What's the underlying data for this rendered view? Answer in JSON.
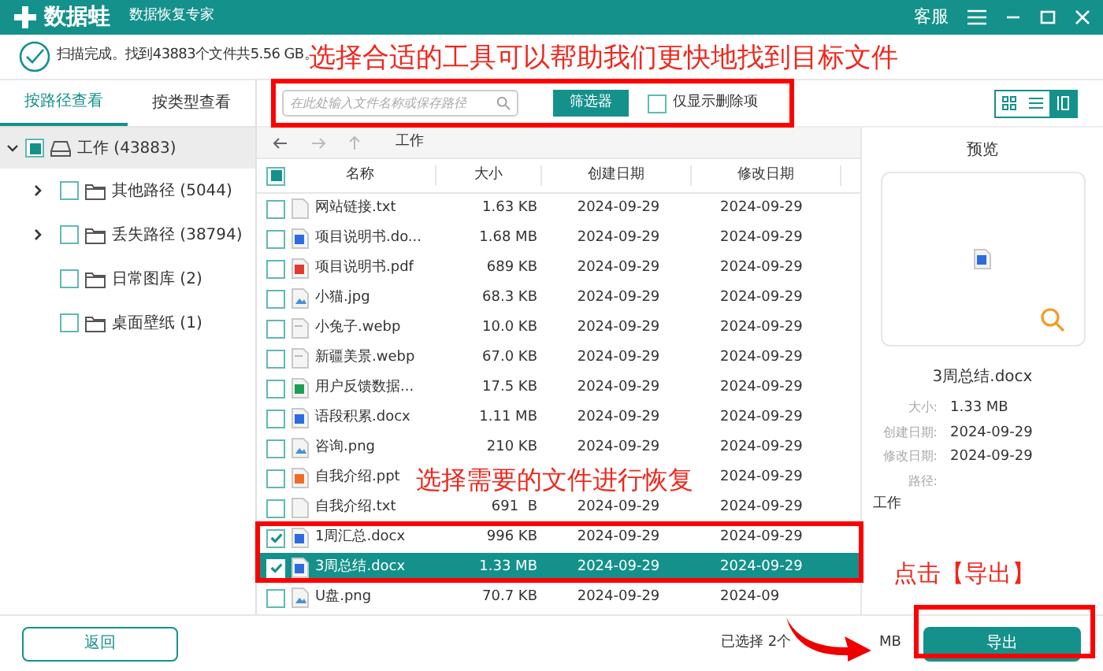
{
  "app": {
    "name": "数据蛙",
    "subtitle": "数据恢复专家",
    "support": "客服"
  },
  "scan_status": "扫描完成。找到43883个文件共5.56 GB。",
  "sidebar": {
    "tabs": [
      {
        "label": "按路径查看",
        "selected": true
      },
      {
        "label": "按类型查看",
        "selected": false
      }
    ],
    "tree": [
      {
        "label": "工作 (43883)",
        "checked": false,
        "indeterminate": true,
        "expanded": true,
        "kind": "drive",
        "selected": true,
        "children": [
          {
            "label": "其他路径 (5044)",
            "checked": false,
            "expandable": true,
            "kind": "folder"
          },
          {
            "label": "丢失路径 (38794)",
            "checked": false,
            "expandable": true,
            "kind": "folder"
          },
          {
            "label": "日常图库 (2)",
            "checked": false,
            "expandable": false,
            "kind": "folder"
          },
          {
            "label": "桌面壁纸 (1)",
            "checked": false,
            "expandable": false,
            "kind": "folder"
          }
        ]
      }
    ]
  },
  "toolbar": {
    "search": {
      "placeholder": "在此处输入文件名称或保存路径"
    },
    "filter_button": "筛选器",
    "deleted_only": {
      "label": "仅显示删除项",
      "checked": false
    },
    "views": [
      {
        "kind": "grid",
        "selected": false
      },
      {
        "kind": "list",
        "selected": false
      },
      {
        "kind": "detail",
        "selected": true
      }
    ]
  },
  "path": "工作",
  "table": {
    "columns": [
      "名称",
      "大小",
      "创建日期",
      "修改日期"
    ],
    "all_checked": false,
    "all_indeterminate": true,
    "rows": [
      {
        "kind": "txt",
        "name": "网站链接.txt",
        "size": "1.63 KB",
        "created": "2024-09-29",
        "modified": "2024-09-29",
        "checked": false,
        "selected": false
      },
      {
        "kind": "doc",
        "name": "项目说明书.do...",
        "size": "1.68 MB",
        "created": "2024-09-29",
        "modified": "2024-09-29",
        "checked": false,
        "selected": false
      },
      {
        "kind": "pdf",
        "name": "项目说明书.pdf",
        "size": "689 KB",
        "created": "2024-09-29",
        "modified": "2024-09-29",
        "checked": false,
        "selected": false
      },
      {
        "kind": "image",
        "name": "小猫.jpg",
        "size": "68.3 KB",
        "created": "2024-09-29",
        "modified": "2024-09-29",
        "checked": false,
        "selected": false
      },
      {
        "kind": "webp",
        "name": "小兔子.webp",
        "size": "10.0 KB",
        "created": "2024-09-29",
        "modified": "2024-09-29",
        "checked": false,
        "selected": false
      },
      {
        "kind": "webp",
        "name": "新疆美景.webp",
        "size": "67.0 KB",
        "created": "2024-09-29",
        "modified": "2024-09-29",
        "checked": false,
        "selected": false
      },
      {
        "kind": "sheet",
        "name": "用户反馈数据...",
        "size": "17.5 KB",
        "created": "2024-09-29",
        "modified": "2024-09-29",
        "checked": false,
        "selected": false
      },
      {
        "kind": "doc",
        "name": "语段积累.docx",
        "size": "1.11 MB",
        "created": "2024-09-29",
        "modified": "2024-09-29",
        "checked": false,
        "selected": false
      },
      {
        "kind": "image",
        "name": "咨询.png",
        "size": "210 KB",
        "created": "2024-09-29",
        "modified": "2024-09-29",
        "checked": false,
        "selected": false
      },
      {
        "kind": "slides",
        "name": "自我介绍.ppt",
        "modified": "2024-09-29",
        "checked": false,
        "selected": false
      },
      {
        "kind": "txt",
        "name": "自我介绍.txt",
        "size": "691  B",
        "created": "2024-09-29",
        "modified": "2024-09-29",
        "checked": false,
        "selected": false
      },
      {
        "kind": "doc",
        "name": "1周汇总.docx",
        "size": "996 KB",
        "created": "2024-09-29",
        "modified": "2024-09-29",
        "checked": true,
        "selected": false
      },
      {
        "kind": "doc",
        "name": "3周总结.docx",
        "size": "1.33 MB",
        "created": "2024-09-29",
        "modified": "2024-09-29",
        "checked": true,
        "selected": true
      },
      {
        "kind": "image",
        "name": "U盘.png",
        "size": "70.7 KB",
        "created": "2024-09-29",
        "modified": "2024-09",
        "checked": false,
        "selected": false
      }
    ]
  },
  "preview": {
    "title": "预览",
    "file_name": "3周总结.docx",
    "details": [
      {
        "label": "大小:",
        "value": "1.33 MB"
      },
      {
        "label": "创建日期:",
        "value": "2024-09-29"
      },
      {
        "label": "修改日期:",
        "value": "2024-09-29"
      },
      {
        "label": "路径:"
      }
    ],
    "path_value": "工作"
  },
  "footer": {
    "back_button": "返回",
    "selection": "已选择 2个",
    "selection_unit": "MB",
    "export_button": "导出"
  },
  "annotations": {
    "headline": "选择合适的工具可以帮助我们更快地找到目标文件",
    "select_hint": "选择需要的文件进行恢复",
    "export_hint": "点击【导出】"
  }
}
